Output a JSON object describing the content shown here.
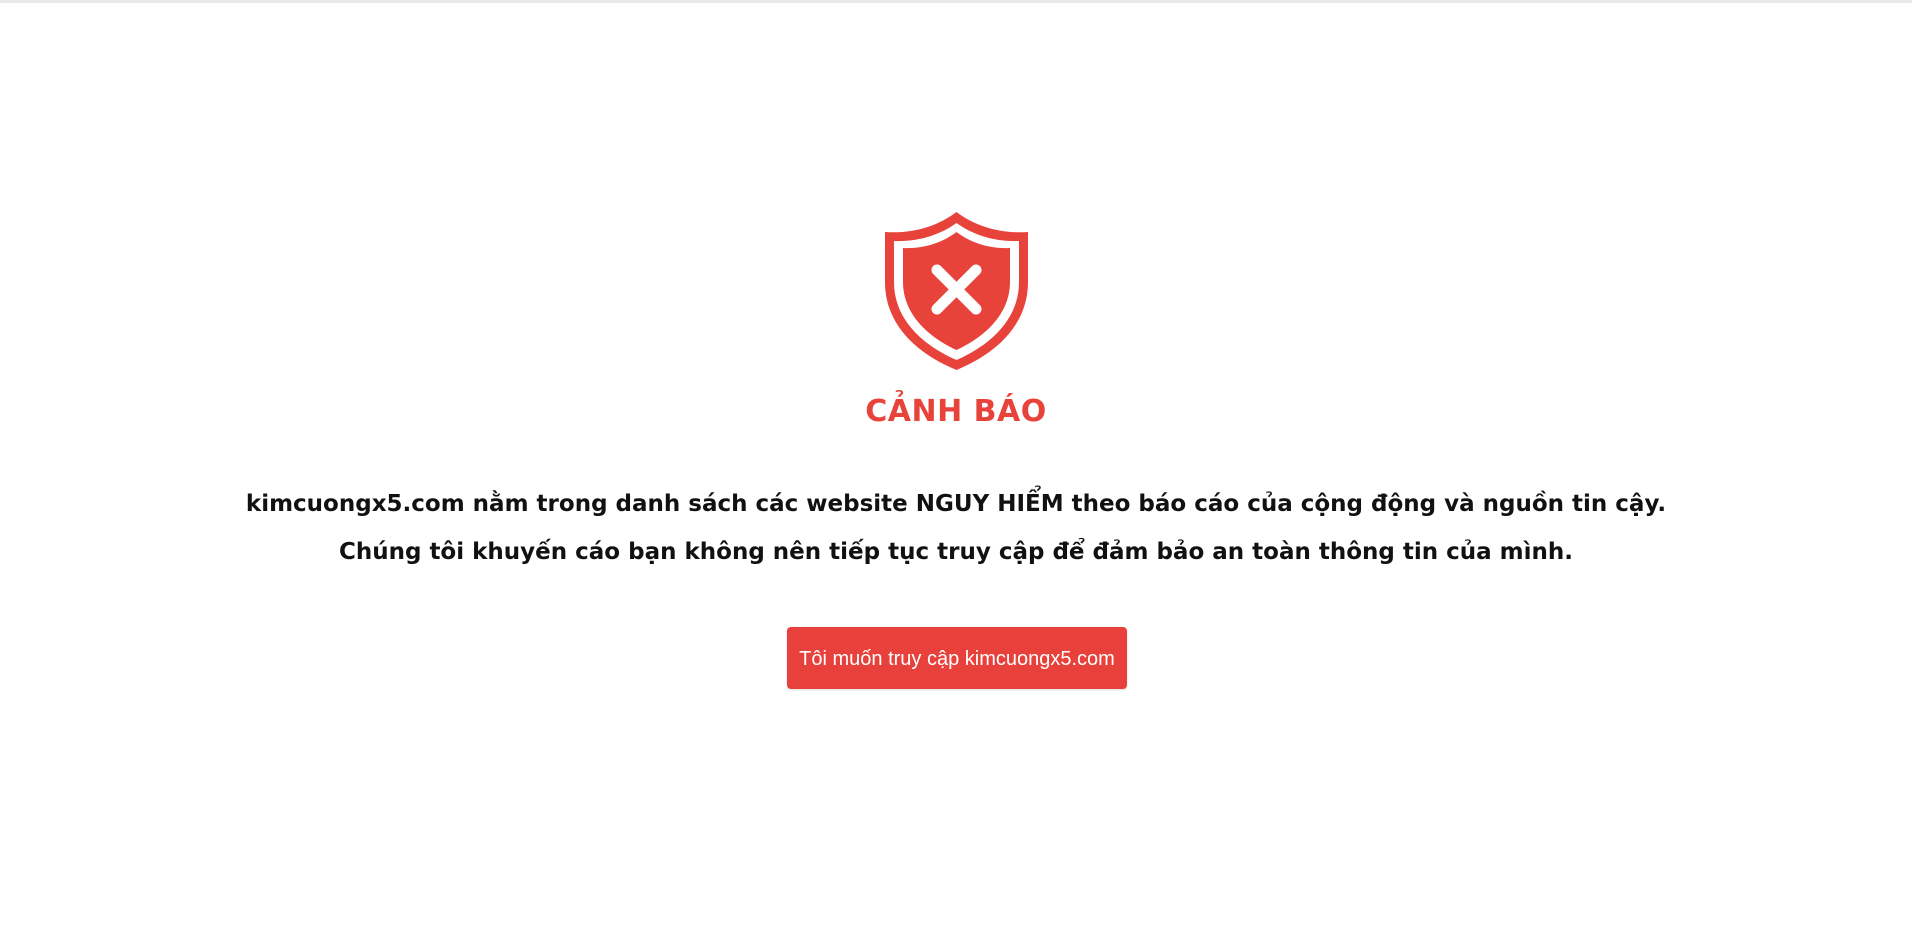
{
  "colors": {
    "accent": "#e8433a",
    "button_bg": "#e8403a",
    "text": "#111111",
    "background": "#ffffff"
  },
  "icon": {
    "name": "shield-x-icon"
  },
  "warning": {
    "title": "CẢNH BÁO",
    "line1": "kimcuongx5.com nằm trong danh sách các website NGUY HIỂM theo báo cáo của cộng động và nguồn tin cậy.",
    "line2": "Chúng tôi khuyến cáo bạn không nên tiếp tục truy cập để đảm bảo an toàn thông tin của mình."
  },
  "action": {
    "proceed_label": "Tôi muốn truy cập kimcuongx5.com"
  }
}
